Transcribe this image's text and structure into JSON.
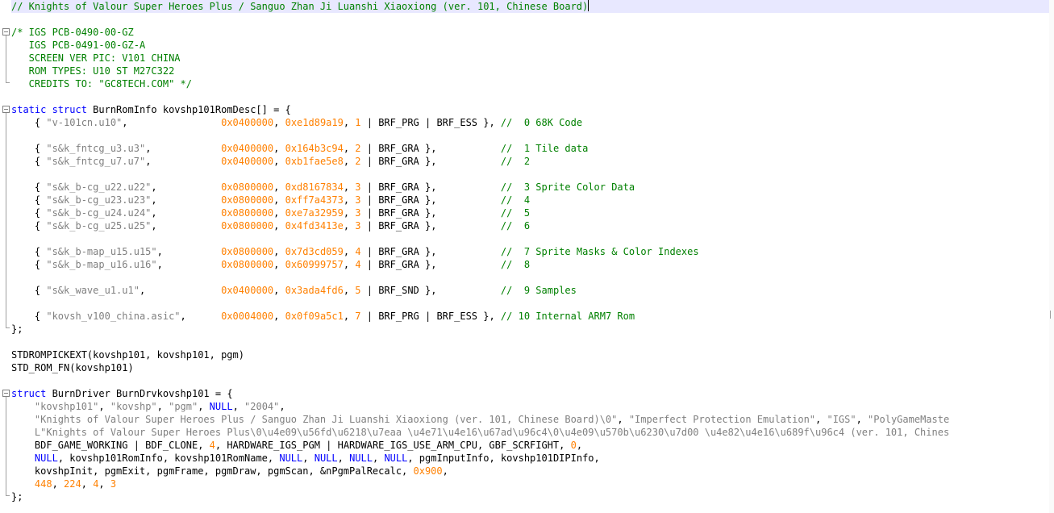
{
  "colors": {
    "comment": "#008000",
    "keyword": "#0000ff",
    "string": "#808080",
    "number": "#ff8000",
    "default": "#000000",
    "current_line": "#e8e8ff"
  },
  "lines": [
    [
      [
        "comment",
        "// Knights of Valour Super Heroes Plus / Sanguo Zhan Ji Luanshi Xiaoxiong (ver. 101, Chinese Board)"
      ]
    ],
    [],
    [
      [
        "comment",
        "/* IGS PCB-0490-00-GZ"
      ]
    ],
    [
      [
        "comment",
        "   IGS PCB-0491-00-GZ-A"
      ]
    ],
    [
      [
        "comment",
        "   SCREEN VER PIC: V101 CHINA"
      ]
    ],
    [
      [
        "comment",
        "   ROM TYPES: U10 ST M27C322"
      ]
    ],
    [
      [
        "comment",
        "   CREDITS TO: \"GC8TECH.COM\" */"
      ]
    ],
    [],
    [
      [
        "keyword",
        "static struct"
      ],
      [
        "default",
        " BurnRomInfo kovshp101RomDesc[] = {"
      ]
    ],
    [
      [
        "default",
        "    { "
      ],
      [
        "string",
        "\"v-101cn.u10\""
      ],
      [
        "default",
        ",                "
      ],
      [
        "number",
        "0x0400000"
      ],
      [
        "default",
        ", "
      ],
      [
        "number",
        "0xe1d89a19"
      ],
      [
        "default",
        ", "
      ],
      [
        "number",
        "1"
      ],
      [
        "default",
        " | BRF_PRG | BRF_ESS }, "
      ],
      [
        "comment",
        "//  0 68K Code"
      ]
    ],
    [],
    [
      [
        "default",
        "    { "
      ],
      [
        "string",
        "\"s&k_fntcg_u3.u3\""
      ],
      [
        "default",
        ",            "
      ],
      [
        "number",
        "0x0400000"
      ],
      [
        "default",
        ", "
      ],
      [
        "number",
        "0x164b3c94"
      ],
      [
        "default",
        ", "
      ],
      [
        "number",
        "2"
      ],
      [
        "default",
        " | BRF_GRA },           "
      ],
      [
        "comment",
        "//  1 Tile data"
      ]
    ],
    [
      [
        "default",
        "    { "
      ],
      [
        "string",
        "\"s&k_fntcg_u7.u7\""
      ],
      [
        "default",
        ",            "
      ],
      [
        "number",
        "0x0400000"
      ],
      [
        "default",
        ", "
      ],
      [
        "number",
        "0xb1fae5e8"
      ],
      [
        "default",
        ", "
      ],
      [
        "number",
        "2"
      ],
      [
        "default",
        " | BRF_GRA },           "
      ],
      [
        "comment",
        "//  2"
      ]
    ],
    [],
    [
      [
        "default",
        "    { "
      ],
      [
        "string",
        "\"s&k_b-cg_u22.u22\""
      ],
      [
        "default",
        ",           "
      ],
      [
        "number",
        "0x0800000"
      ],
      [
        "default",
        ", "
      ],
      [
        "number",
        "0xd8167834"
      ],
      [
        "default",
        ", "
      ],
      [
        "number",
        "3"
      ],
      [
        "default",
        " | BRF_GRA },           "
      ],
      [
        "comment",
        "//  3 Sprite Color Data"
      ]
    ],
    [
      [
        "default",
        "    { "
      ],
      [
        "string",
        "\"s&k_b-cg_u23.u23\""
      ],
      [
        "default",
        ",           "
      ],
      [
        "number",
        "0x0800000"
      ],
      [
        "default",
        ", "
      ],
      [
        "number",
        "0xff7a4373"
      ],
      [
        "default",
        ", "
      ],
      [
        "number",
        "3"
      ],
      [
        "default",
        " | BRF_GRA },           "
      ],
      [
        "comment",
        "//  4"
      ]
    ],
    [
      [
        "default",
        "    { "
      ],
      [
        "string",
        "\"s&k_b-cg_u24.u24\""
      ],
      [
        "default",
        ",           "
      ],
      [
        "number",
        "0x0800000"
      ],
      [
        "default",
        ", "
      ],
      [
        "number",
        "0xe7a32959"
      ],
      [
        "default",
        ", "
      ],
      [
        "number",
        "3"
      ],
      [
        "default",
        " | BRF_GRA },           "
      ],
      [
        "comment",
        "//  5"
      ]
    ],
    [
      [
        "default",
        "    { "
      ],
      [
        "string",
        "\"s&k_b-cg_u25.u25\""
      ],
      [
        "default",
        ",           "
      ],
      [
        "number",
        "0x0800000"
      ],
      [
        "default",
        ", "
      ],
      [
        "number",
        "0x4fd3413e"
      ],
      [
        "default",
        ", "
      ],
      [
        "number",
        "3"
      ],
      [
        "default",
        " | BRF_GRA },           "
      ],
      [
        "comment",
        "//  6"
      ]
    ],
    [],
    [
      [
        "default",
        "    { "
      ],
      [
        "string",
        "\"s&k_b-map_u15.u15\""
      ],
      [
        "default",
        ",          "
      ],
      [
        "number",
        "0x0800000"
      ],
      [
        "default",
        ", "
      ],
      [
        "number",
        "0x7d3cd059"
      ],
      [
        "default",
        ", "
      ],
      [
        "number",
        "4"
      ],
      [
        "default",
        " | BRF_GRA },           "
      ],
      [
        "comment",
        "//  7 Sprite Masks & Color Indexes"
      ]
    ],
    [
      [
        "default",
        "    { "
      ],
      [
        "string",
        "\"s&k_b-map_u16.u16\""
      ],
      [
        "default",
        ",          "
      ],
      [
        "number",
        "0x0800000"
      ],
      [
        "default",
        ", "
      ],
      [
        "number",
        "0x60999757"
      ],
      [
        "default",
        ", "
      ],
      [
        "number",
        "4"
      ],
      [
        "default",
        " | BRF_GRA },           "
      ],
      [
        "comment",
        "//  8"
      ]
    ],
    [],
    [
      [
        "default",
        "    { "
      ],
      [
        "string",
        "\"s&k_wave_u1.u1\""
      ],
      [
        "default",
        ",             "
      ],
      [
        "number",
        "0x0400000"
      ],
      [
        "default",
        ", "
      ],
      [
        "number",
        "0x3ada4fd6"
      ],
      [
        "default",
        ", "
      ],
      [
        "number",
        "5"
      ],
      [
        "default",
        " | BRF_SND },           "
      ],
      [
        "comment",
        "//  9 Samples"
      ]
    ],
    [],
    [
      [
        "default",
        "    { "
      ],
      [
        "string",
        "\"kovsh_v100_china.asic\""
      ],
      [
        "default",
        ",      "
      ],
      [
        "number",
        "0x0004000"
      ],
      [
        "default",
        ", "
      ],
      [
        "number",
        "0x0f09a5c1"
      ],
      [
        "default",
        ", "
      ],
      [
        "number",
        "7"
      ],
      [
        "default",
        " | BRF_PRG | BRF_ESS }, "
      ],
      [
        "comment",
        "// 10 Internal ARM7 Rom"
      ]
    ],
    [
      [
        "default",
        "};"
      ]
    ],
    [],
    [
      [
        "default",
        "STDROMPICKEXT(kovshp101, kovshp101, pgm)"
      ]
    ],
    [
      [
        "default",
        "STD_ROM_FN(kovshp101)"
      ]
    ],
    [],
    [
      [
        "keyword",
        "struct"
      ],
      [
        "default",
        " BurnDriver BurnDrvkovshp101 = {"
      ]
    ],
    [
      [
        "default",
        "    "
      ],
      [
        "string",
        "\"kovshp101\""
      ],
      [
        "default",
        ", "
      ],
      [
        "string",
        "\"kovshp\""
      ],
      [
        "default",
        ", "
      ],
      [
        "string",
        "\"pgm\""
      ],
      [
        "default",
        ", "
      ],
      [
        "keyword",
        "NULL"
      ],
      [
        "default",
        ", "
      ],
      [
        "string",
        "\"2004\""
      ],
      [
        "default",
        ","
      ]
    ],
    [
      [
        "default",
        "    "
      ],
      [
        "string",
        "\"Knights of Valour Super Heroes Plus / Sanguo Zhan Ji Luanshi Xiaoxiong (ver. 101, Chinese Board)\\0\""
      ],
      [
        "default",
        ", "
      ],
      [
        "string",
        "\"Imperfect Protection Emulation\""
      ],
      [
        "default",
        ", "
      ],
      [
        "string",
        "\"IGS\""
      ],
      [
        "default",
        ", "
      ],
      [
        "string",
        "\"PolyGameMaste"
      ]
    ],
    [
      [
        "default",
        "    "
      ],
      [
        "string",
        "L\"Knights of Valour Super Heroes Plus\\0\\u4e09\\u56fd\\u6218\\u7eaa \\u4e71\\u4e16\\u67ad\\u96c4\\0\\u4e09\\u570b\\u6230\\u7d00 \\u4e82\\u4e16\\u689f\\u96c4 (ver. 101, Chines"
      ]
    ],
    [
      [
        "default",
        "    BDF_GAME_WORKING | BDF_CLONE, "
      ],
      [
        "number",
        "4"
      ],
      [
        "default",
        ", HARDWARE_IGS_PGM | HARDWARE_IGS_USE_ARM_CPU, GBF_SCRFIGHT, "
      ],
      [
        "number",
        "0"
      ],
      [
        "default",
        ","
      ]
    ],
    [
      [
        "default",
        "    "
      ],
      [
        "keyword",
        "NULL"
      ],
      [
        "default",
        ", kovshp101RomInfo, kovshp101RomName, "
      ],
      [
        "keyword",
        "NULL"
      ],
      [
        "default",
        ", "
      ],
      [
        "keyword",
        "NULL"
      ],
      [
        "default",
        ", "
      ],
      [
        "keyword",
        "NULL"
      ],
      [
        "default",
        ", "
      ],
      [
        "keyword",
        "NULL"
      ],
      [
        "default",
        ", pgmInputInfo, kovshp101DIPInfo,"
      ]
    ],
    [
      [
        "default",
        "    kovshpInit, pgmExit, pgmFrame, pgmDraw, pgmScan, &nPgmPalRecalc, "
      ],
      [
        "number",
        "0x900"
      ],
      [
        "default",
        ","
      ]
    ],
    [
      [
        "default",
        "    "
      ],
      [
        "number",
        "448"
      ],
      [
        "default",
        ", "
      ],
      [
        "number",
        "224"
      ],
      [
        "default",
        ", "
      ],
      [
        "number",
        "4"
      ],
      [
        "default",
        ", "
      ],
      [
        "number",
        "3"
      ]
    ],
    [
      [
        "default",
        "};"
      ]
    ]
  ]
}
